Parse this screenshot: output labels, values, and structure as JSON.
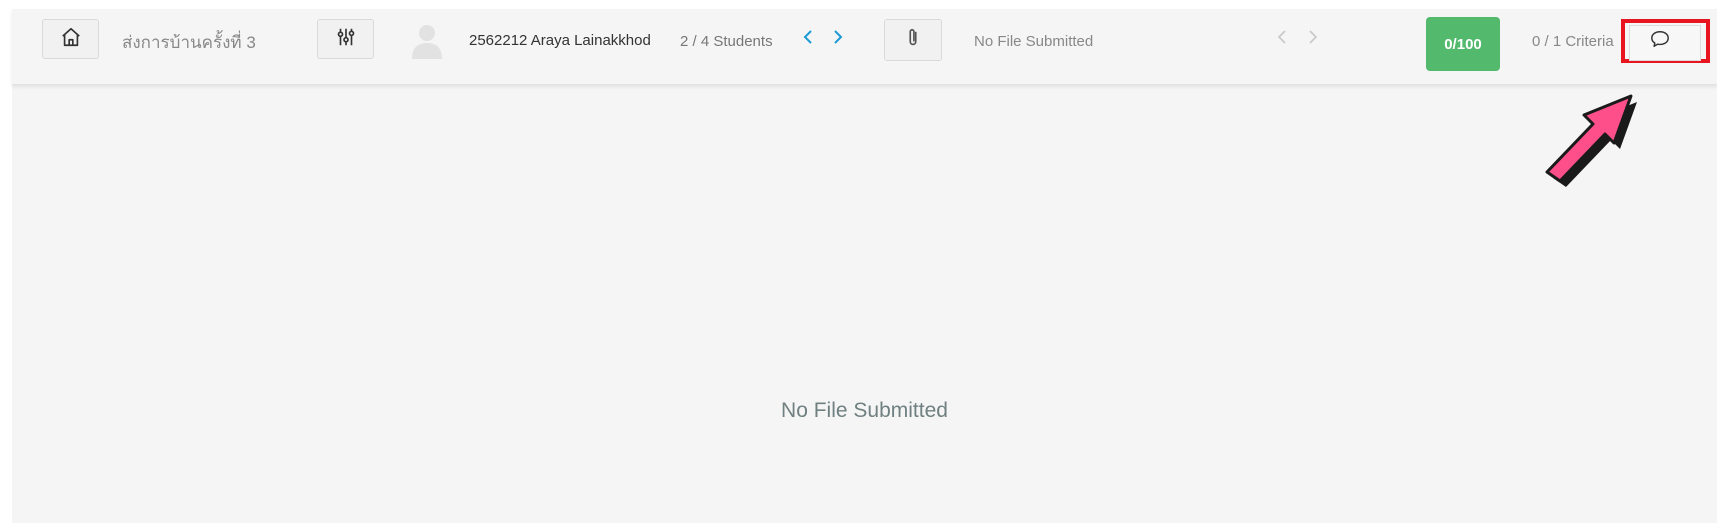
{
  "header": {
    "assignment_title": "ส่งการบ้านครั้งที่ 3",
    "student_name": "2562212 Araya Lainakkhod",
    "student_count": "2 / 4 Students",
    "file_status": "No File Submitted",
    "score": "0/100",
    "criteria": "0 / 1 Criteria"
  },
  "main": {
    "message": "No File Submitted"
  },
  "icons": {
    "home": "home-icon",
    "filter": "sliders-icon",
    "avatar": "user-avatar-icon",
    "attachment": "paperclip-icon",
    "comment": "comment-icon"
  },
  "colors": {
    "score_bg": "#52b96d",
    "highlight": "#e8141f",
    "arrow": "#ff4f8b",
    "nav_arrow": "#1b9ad6"
  }
}
